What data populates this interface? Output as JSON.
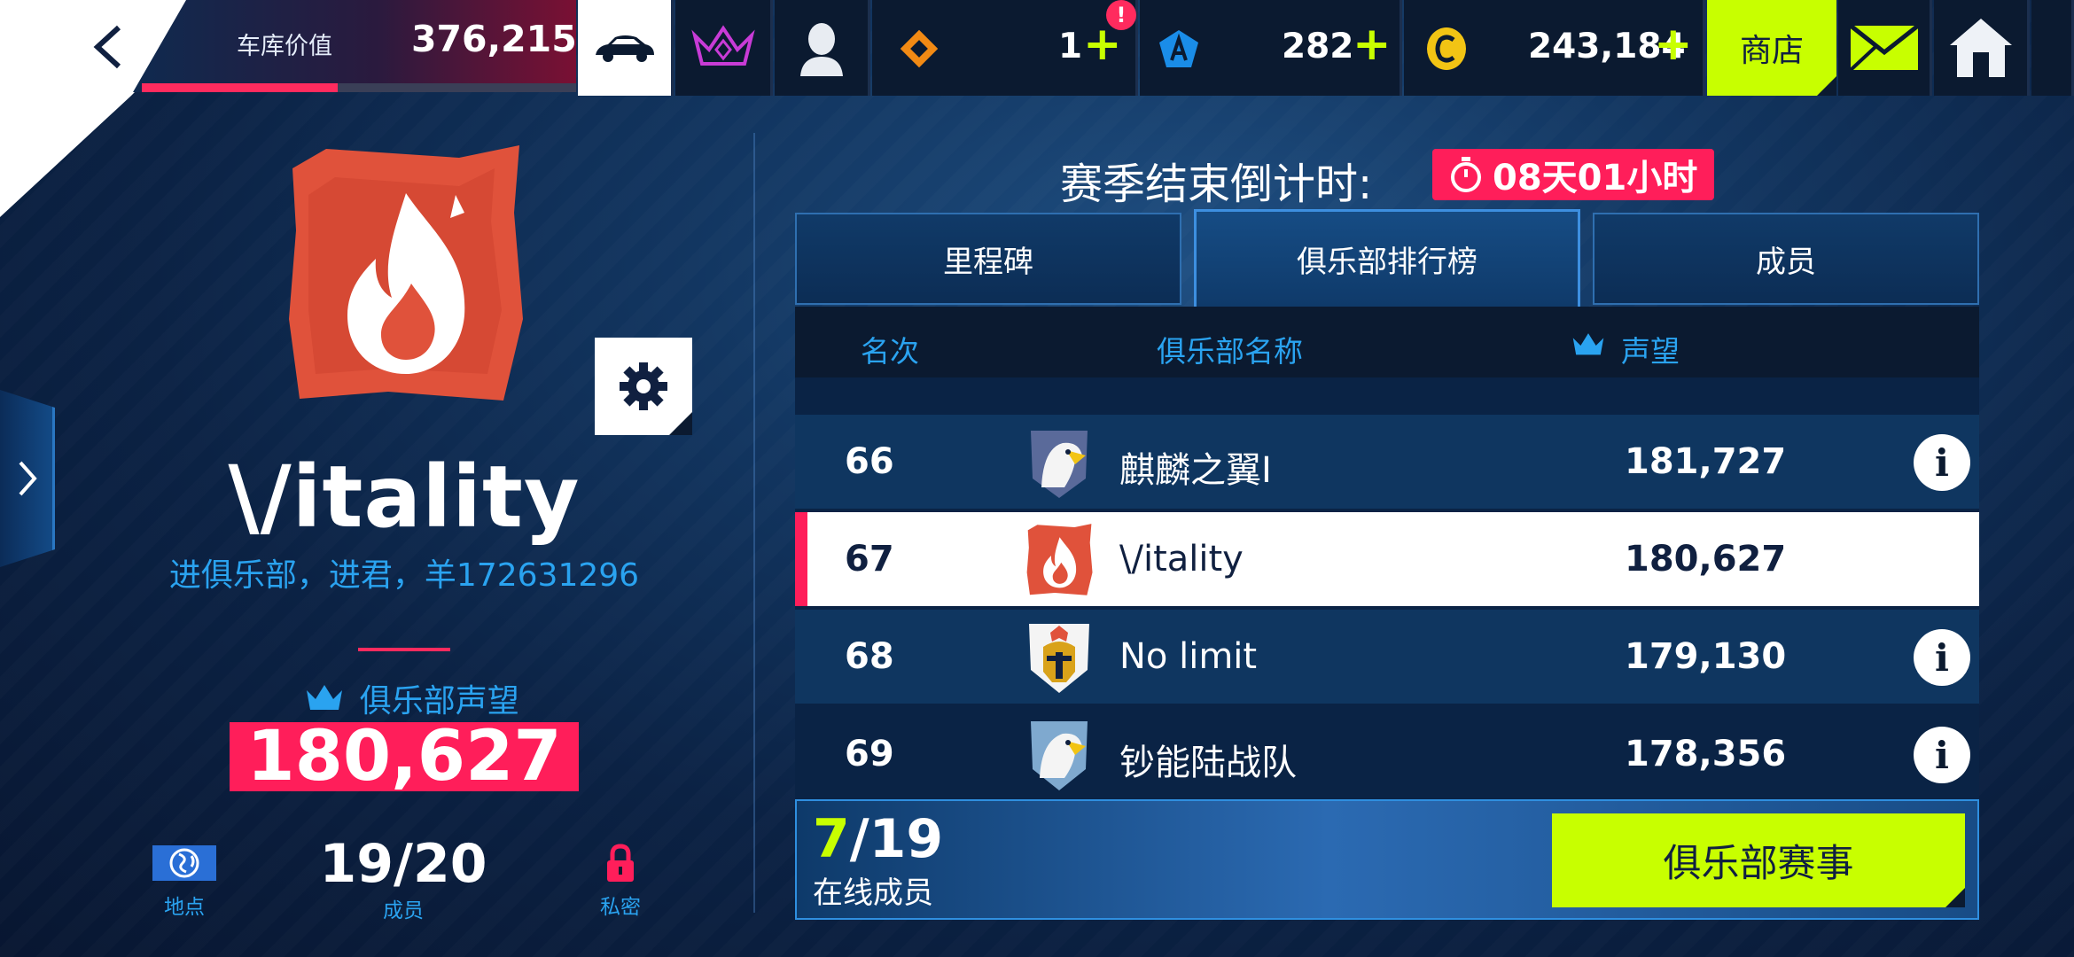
{
  "topbar": {
    "garage_value_label": "车库价值",
    "garage_value": "376,215",
    "garage_progress_fraction": 0.45,
    "alert_badge": "!",
    "tokens_count": "1",
    "blueprints_count": "282",
    "credits_count": "243,184",
    "plus": "+",
    "shop_label": "商店"
  },
  "club": {
    "name": "\\/itality",
    "motto": "进俱乐部，进君，羊172631296",
    "reputation_label": "俱乐部声望",
    "reputation_value": "180,627",
    "location_label": "地点",
    "members_value": "19/20",
    "members_label": "成员",
    "privacy_label": "私密"
  },
  "season": {
    "countdown_label": "赛季结束倒计时:",
    "countdown_value": "08天01小时"
  },
  "tabs": [
    {
      "label": "里程碑"
    },
    {
      "label": "俱乐部排行榜"
    },
    {
      "label": "成员"
    }
  ],
  "table": {
    "headers": {
      "rank": "名次",
      "name": "俱乐部名称",
      "reputation": "声望"
    },
    "rows": [
      {
        "rank": "66",
        "name": "麒麟之翼I",
        "score": "181,727"
      },
      {
        "rank": "67",
        "name": "\\/itality",
        "score": "180,627"
      },
      {
        "rank": "68",
        "name": "No limit",
        "score": "179,130"
      },
      {
        "rank": "69",
        "name": "钞能陆战队",
        "score": "178,356"
      }
    ],
    "info_glyph": "i"
  },
  "footer": {
    "online_now": "7",
    "online_total": "/19",
    "online_label": "在线成员",
    "club_event_button": "俱乐部赛事"
  },
  "colors": {
    "accent_pink": "#ff1e5a",
    "accent_lime": "#c8ff00",
    "text_blue": "#2aa3f0",
    "logo_orange": "#e0523b"
  }
}
